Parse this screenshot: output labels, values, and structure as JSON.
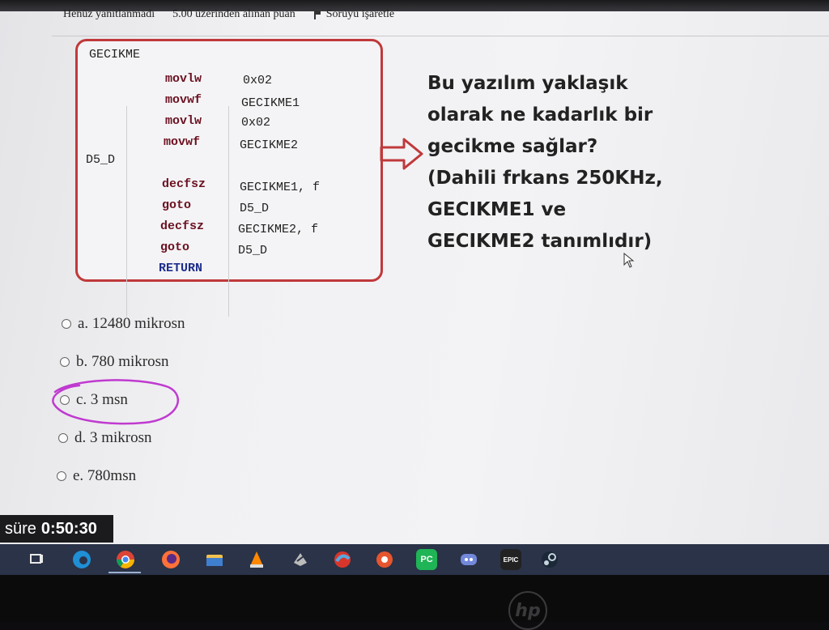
{
  "status": {
    "answered": "Henüz yanıtlanmadı",
    "points": "5.00 üzerinden alınan puan",
    "flag_label": "Soruyu işaretle"
  },
  "code": {
    "label1": "GECIKME",
    "label2": "D5_D",
    "lines": [
      {
        "op": "movlw",
        "arg": "0x02"
      },
      {
        "op": "movwf",
        "arg": "GECIKME1"
      },
      {
        "op": "movlw",
        "arg": "0x02"
      },
      {
        "op": "movwf",
        "arg": "GECIKME2"
      },
      {
        "op": "decfsz",
        "arg": "GECIKME1, f"
      },
      {
        "op": "goto",
        "arg": "D5_D"
      },
      {
        "op": "decfsz",
        "arg": "GECIKME2, f"
      },
      {
        "op": "goto",
        "arg": "D5_D"
      }
    ],
    "return": "RETURN"
  },
  "question": {
    "lines": [
      "Bu yazılım yaklaşık",
      "olarak ne kadarlık bir",
      "gecikme sağlar?",
      "(Dahili frkans 250KHz,",
      "GECIKME1 ve",
      "GECIKME2 tanımlıdır)"
    ]
  },
  "options": [
    {
      "label": "a. 12480 mikrosn"
    },
    {
      "label": "b. 780 mikrosn"
    },
    {
      "label": "c. 3 msn"
    },
    {
      "label": "d. 3 mikrosn"
    },
    {
      "label": "e. 780msn"
    }
  ],
  "timer": {
    "label": "süre",
    "value": "0:50:30"
  },
  "taskbar": {
    "icons": [
      "task-view-icon",
      "edge-icon",
      "chrome-icon",
      "firefox-icon",
      "file-explorer-icon",
      "vlc-icon",
      "app-icon",
      "ccleaner-icon",
      "app-icon-2",
      "pycharm-icon",
      "discord-icon",
      "epic-games-icon",
      "steam-icon"
    ],
    "pycharm_text": "PC",
    "epic_text": "EPIC"
  },
  "bezel": {
    "logo": "hp"
  },
  "colors": {
    "code_border": "#c0393b",
    "marker": "#c03ad0",
    "taskbar": "#2a3348"
  }
}
